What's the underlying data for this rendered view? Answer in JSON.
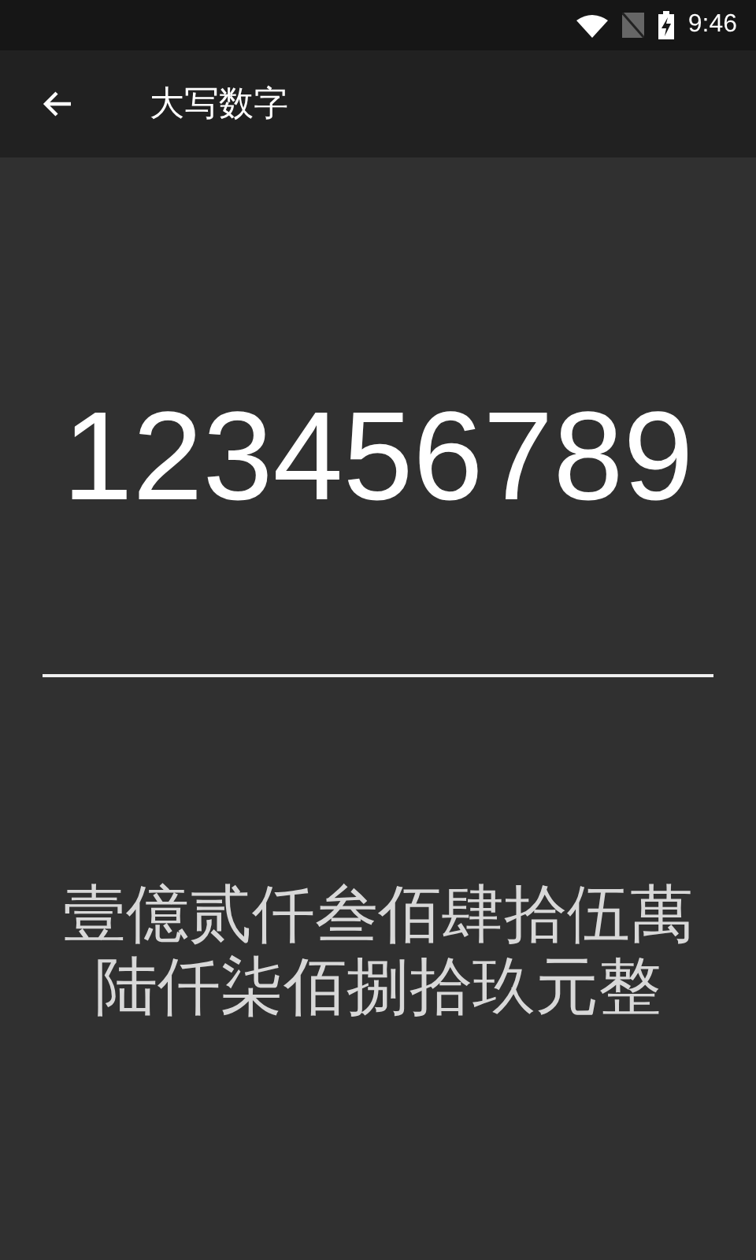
{
  "status_bar": {
    "time": "9:46"
  },
  "app_bar": {
    "title": "大写数字"
  },
  "number_field": {
    "value": "123456789"
  },
  "result": {
    "text": "壹億贰仟叁佰肆拾伍萬陆仟柒佰捌拾玖元整"
  }
}
